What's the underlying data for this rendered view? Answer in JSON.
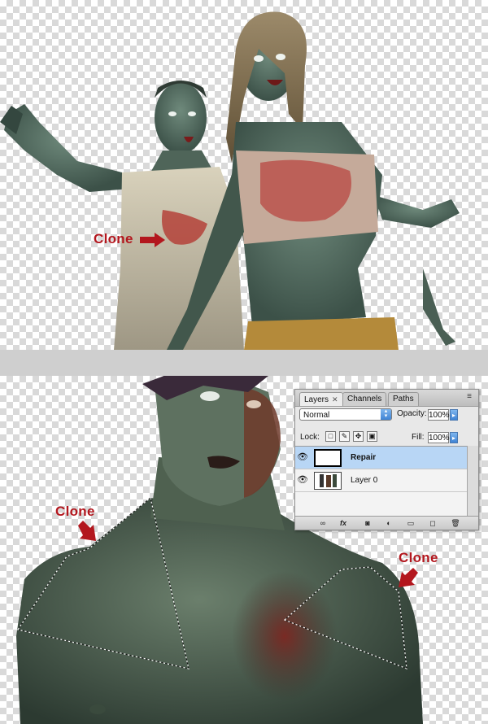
{
  "annotations": {
    "clone_top": "Clone",
    "clone_bottom_left": "Clone",
    "clone_bottom_right": "Clone"
  },
  "colors": {
    "accent_red": "#b3171e",
    "selection_blue": "#b8d6f5",
    "checker_gray": "#d9d9d9",
    "divider_gray": "#cfcfcf"
  },
  "layers_panel": {
    "tabs": [
      {
        "label": "Layers",
        "active": true,
        "closable": true
      },
      {
        "label": "Channels",
        "active": false
      },
      {
        "label": "Paths",
        "active": false
      }
    ],
    "blend_mode": "Normal",
    "opacity_label": "Opacity:",
    "opacity_value": "100%",
    "lock_label": "Lock:",
    "fill_label": "Fill:",
    "fill_value": "100%",
    "lock_icons": [
      "lock-transparent-icon",
      "lock-pixels-icon",
      "lock-position-icon",
      "lock-all-icon"
    ],
    "layers": [
      {
        "name": "Repair",
        "visible": true,
        "selected": true
      },
      {
        "name": "Layer 0",
        "visible": true,
        "selected": false
      }
    ],
    "bottom_icons": [
      "link-layers-icon",
      "fx-icon",
      "layer-mask-icon",
      "adjustment-layer-icon",
      "new-group-icon",
      "new-layer-icon",
      "trash-icon"
    ]
  }
}
